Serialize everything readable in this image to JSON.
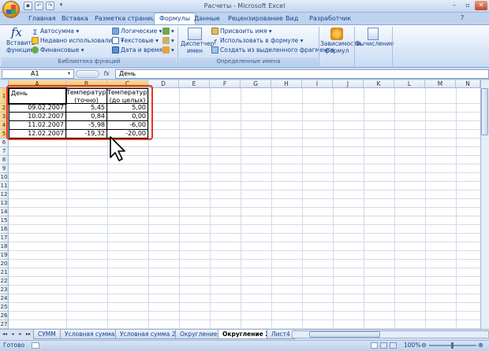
{
  "window": {
    "title": "Расчеты - Microsoft Excel"
  },
  "tabs": [
    "Главная",
    "Вставка",
    "Разметка страницы",
    "Формулы",
    "Данные",
    "Рецензирование",
    "Вид",
    "Разработчик"
  ],
  "active_tab": "Формулы",
  "ribbon": {
    "insert_function": [
      "Вставить",
      "функцию"
    ],
    "autosum": "Автосумма",
    "recent": "Недавно использовались",
    "financial": "Финансовые",
    "logical": "Логические",
    "text": "Текстовые",
    "datetime": "Дата и время",
    "group_library": "Библиотека функций",
    "name_manager": [
      "Диспетчер",
      "имен"
    ],
    "assign_name": "Присвоить имя",
    "use_in_formula": "Использовать в формуле",
    "create_from_selection": "Создать из выделенного фрагмента",
    "group_names": "Определенные имена",
    "dependencies": [
      "Зависимости",
      "формул"
    ],
    "calculation": "Вычисление"
  },
  "formula_bar": {
    "name_box": "A1",
    "fx": "fx",
    "value": "День"
  },
  "columns": [
    "A",
    "B",
    "C",
    "D",
    "E",
    "F",
    "G",
    "H",
    "I",
    "J",
    "K",
    "L",
    "M",
    "N"
  ],
  "rows": [
    "1",
    "2",
    "3",
    "4",
    "5",
    "6",
    "7",
    "8",
    "9",
    "10",
    "11",
    "12",
    "13",
    "14",
    "15",
    "16",
    "17",
    "18",
    "19",
    "20",
    "21",
    "22",
    "23",
    "24",
    "25",
    "26",
    "27"
  ],
  "table": {
    "headers": [
      "День",
      "Температура (точно)",
      "Температура (до целых)"
    ],
    "data": [
      [
        "09.02.2007",
        "5,45",
        "5,00"
      ],
      [
        "10.02.2007",
        "0,84",
        "0,00"
      ],
      [
        "11.02.2007",
        "-5,98",
        "-6,00"
      ],
      [
        "12.02.2007",
        "-19,32",
        "-20,00"
      ]
    ]
  },
  "sheets": [
    "СУММ",
    "Условная сумма",
    "Условная сумма 2",
    "Округление",
    "Округление 2",
    "Лист4"
  ],
  "active_sheet": "Округление 2",
  "status": {
    "ready": "Готово",
    "zoom": "100%"
  },
  "colors": {
    "accent": "#15428b",
    "highlight": "#e8341a"
  }
}
